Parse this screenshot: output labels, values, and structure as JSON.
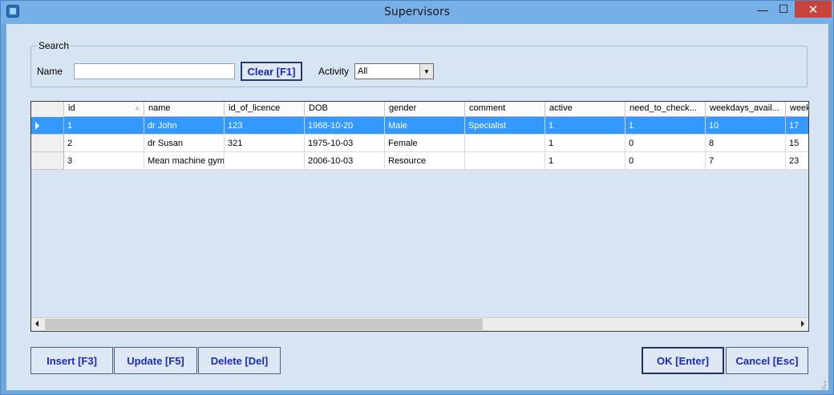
{
  "window": {
    "title": "Supervisors",
    "min_glyph": "—",
    "max_glyph": "☐",
    "close_glyph": "✕"
  },
  "search": {
    "legend": "Search",
    "name_label": "Name",
    "name_value": "",
    "clear_label": "Clear [F1]",
    "activity_label": "Activity",
    "activity_selected": "All"
  },
  "grid": {
    "columns": [
      "id",
      "name",
      "id_of_licence",
      "DOB",
      "gender",
      "comment",
      "active",
      "need_to_check...",
      "weekdays_avail...",
      "week"
    ],
    "rows": [
      [
        "1",
        "dr John",
        "123",
        "1968-10-20",
        "Male",
        "Specialist",
        "1",
        "1",
        "10",
        "17"
      ],
      [
        "2",
        "dr Susan",
        "321",
        "1975-10-03",
        "Female",
        "",
        "1",
        "0",
        "8",
        "15"
      ],
      [
        "3",
        "Mean machine gym",
        "",
        "2006-10-03",
        "Resource",
        "",
        "1",
        "0",
        "7",
        "23"
      ]
    ],
    "selected_row": 0,
    "sort_glyph": "▵"
  },
  "buttons": {
    "insert": "Insert [F3]",
    "update": "Update [F5]",
    "delete": "Delete [Del]",
    "ok": "OK [Enter]",
    "cancel": "Cancel [Esc]"
  },
  "icons": {
    "app": "app-icon",
    "dropdown": "chevron-down-icon",
    "row_pointer": "row-pointer-icon",
    "resize": "resize-grip-icon"
  },
  "colors": {
    "selection": "#3399ff",
    "button_text": "#1c2bb8",
    "close": "#c7433c",
    "window_frame": "#76b0e6"
  }
}
